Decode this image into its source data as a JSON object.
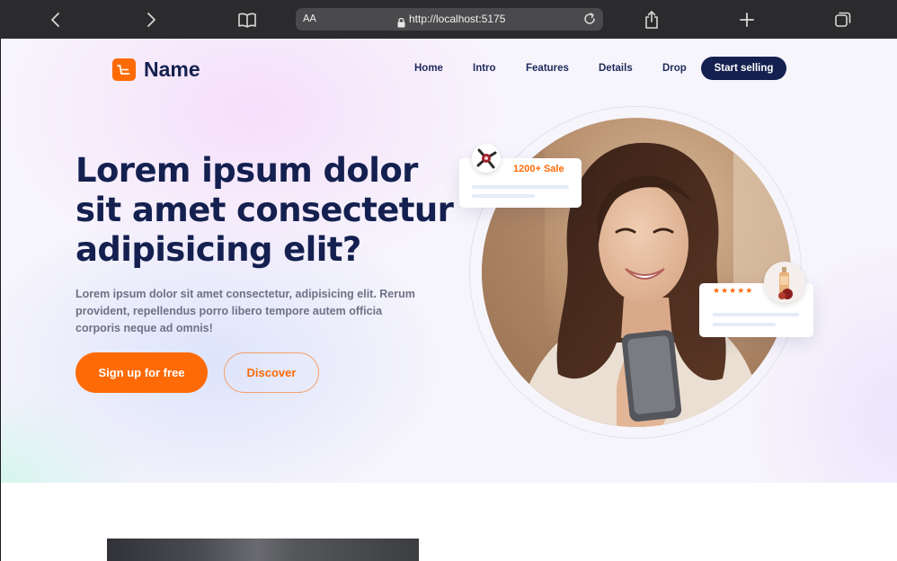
{
  "browser": {
    "text_size_label": "AA",
    "url": "http://localhost:5175"
  },
  "brand": {
    "name": "Name",
    "accent": "#fe6a05",
    "navy": "#14204f"
  },
  "nav": {
    "items": [
      {
        "label": "Home"
      },
      {
        "label": "Intro"
      },
      {
        "label": "Features"
      },
      {
        "label": "Details"
      },
      {
        "label": "Drop"
      }
    ],
    "cta": "Start selling"
  },
  "hero": {
    "headline_lines": [
      "Lorem ipsum dolor",
      "sit amet consectetur",
      "adipisicing elit?"
    ],
    "subtext_lines": [
      "Lorem ipsum dolor sit amet consectetur, adipisicing elit. Rerum",
      "provident, repellendus porro libero tempore autem officia",
      "corporis neque ad omnis!"
    ],
    "primary_button": "Sign up for free",
    "secondary_button": "Discover"
  },
  "cards": {
    "sale": {
      "label": "1200+ Sale"
    },
    "rating": {
      "stars": 5,
      "star_glyphs": "★★★★★"
    }
  },
  "icons": [
    "back-chevron-icon",
    "forward-chevron-icon",
    "book-icon",
    "lock-icon",
    "reload-icon",
    "share-icon",
    "plus-icon",
    "tabs-icon",
    "shopping-bag-icon"
  ]
}
